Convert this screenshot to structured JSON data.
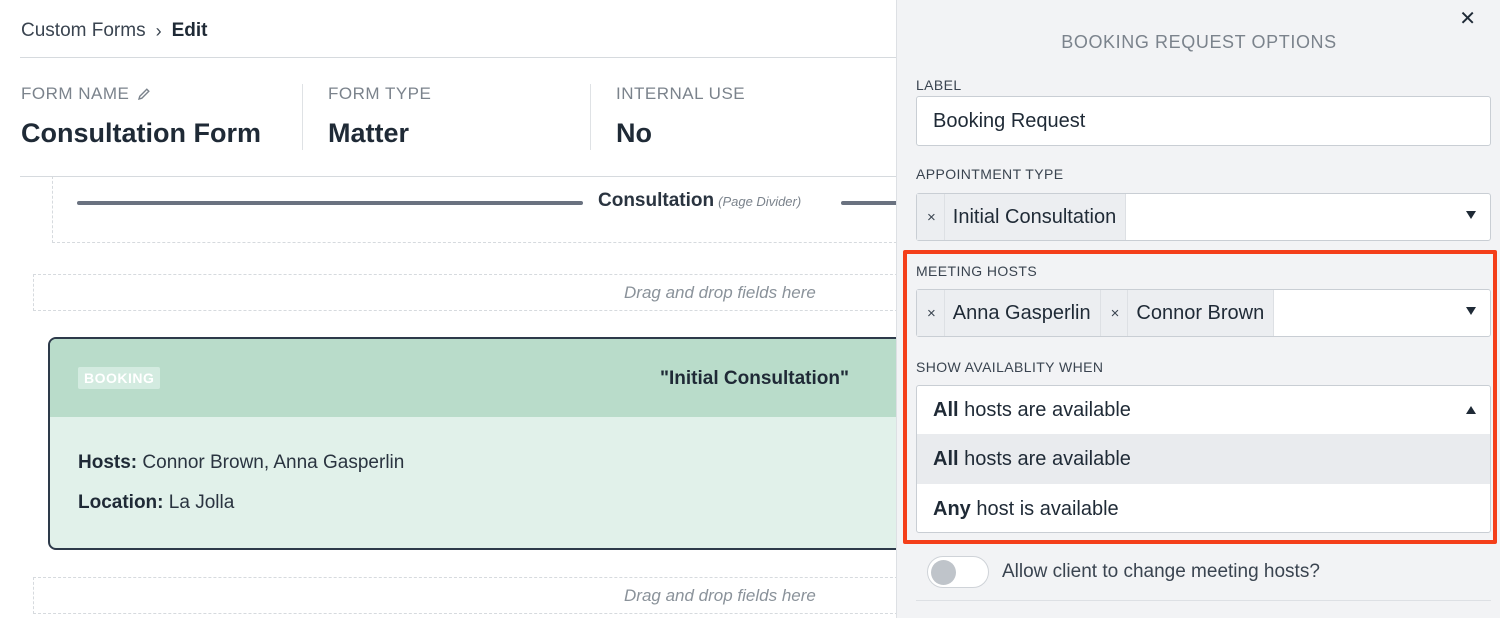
{
  "breadcrumb": {
    "parent": "Custom Forms",
    "current": "Edit"
  },
  "form_meta": [
    {
      "label": "FORM NAME",
      "value": "Consultation Form",
      "editable": true
    },
    {
      "label": "FORM TYPE",
      "value": "Matter"
    },
    {
      "label": "INTERNAL USE",
      "value": "No"
    }
  ],
  "page_divider": {
    "title": "Consultation",
    "note": "(Page Divider)"
  },
  "dropzone_text": "Drag and drop fields here",
  "booking": {
    "badge": "BOOKING",
    "title": "\"Initial Consultation\"",
    "hosts_label": "Hosts:",
    "hosts_value": "Connor Brown, Anna Gasperlin",
    "location_label": "Location:",
    "location_value": "La Jolla"
  },
  "panel": {
    "title": "BOOKING REQUEST OPTIONS",
    "label_field": {
      "label": "LABEL",
      "value": "Booking Request"
    },
    "appointment_type": {
      "label": "APPOINTMENT TYPE",
      "chips": [
        "Initial Consultation"
      ]
    },
    "meeting_hosts": {
      "label": "MEETING HOSTS",
      "chips": [
        "Anna Gasperlin",
        "Connor Brown"
      ]
    },
    "show_availability": {
      "label": "SHOW AVAILABLITY WHEN",
      "selected_strong": "All",
      "selected_rest": " hosts are available",
      "options": [
        {
          "strong": "All",
          "rest": " hosts are available",
          "active": true
        },
        {
          "strong": "Any",
          "rest": " host is available",
          "active": false
        }
      ]
    },
    "toggle": {
      "label": "Allow client to change meeting hosts?",
      "on": false
    }
  },
  "colors": {
    "highlight": "#f43f1a",
    "booking_header": "#b9dcca",
    "booking_body": "#e1f1ea",
    "panel_bg": "#f2f3f5"
  }
}
